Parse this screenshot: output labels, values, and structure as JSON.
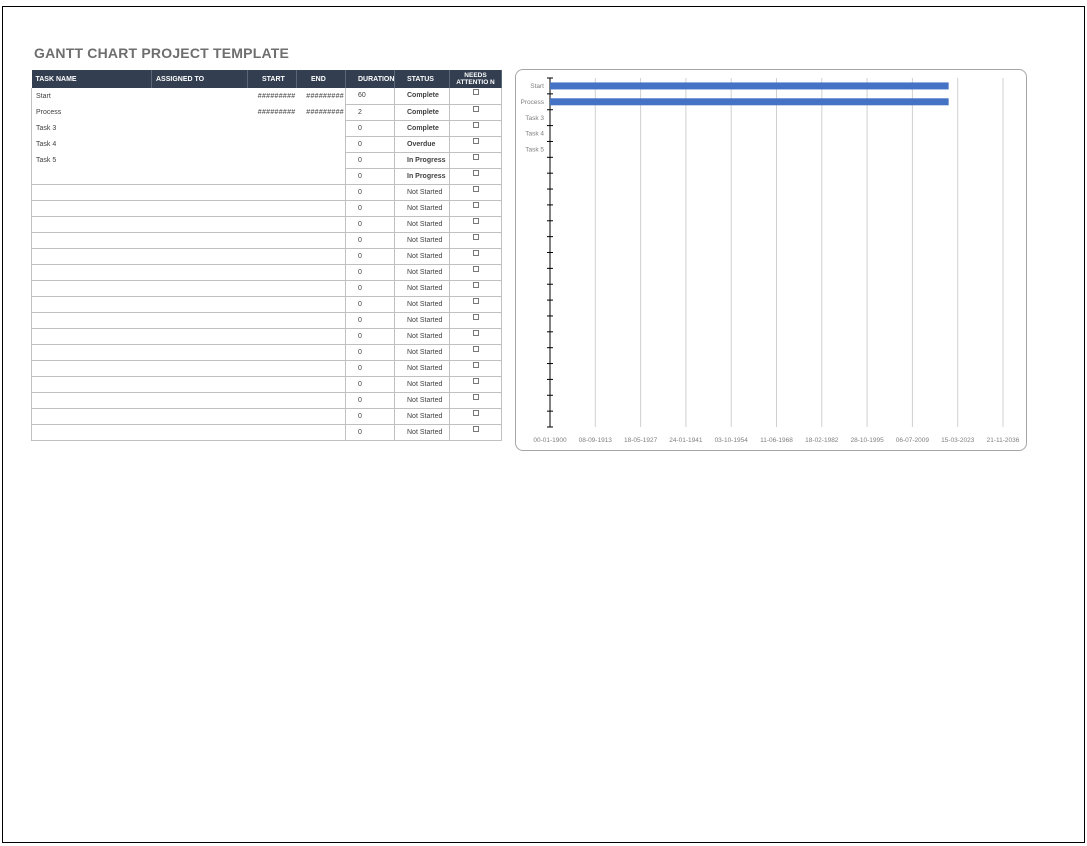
{
  "title": "GANTT CHART PROJECT TEMPLATE",
  "columns": {
    "task": "TASK NAME",
    "assigned": "ASSIGNED TO",
    "start": "START",
    "end": "END",
    "duration": "DURATION",
    "status": "STATUS",
    "needs": "NEEDS ATTENTIO N"
  },
  "rows": [
    {
      "task": "Start",
      "start": "#########",
      "end": "#########",
      "duration": "60",
      "status": "Complete",
      "status_type": "complete"
    },
    {
      "task": "Process",
      "start": "#########",
      "end": "#########",
      "duration": "2",
      "status": "Complete",
      "status_type": "complete"
    },
    {
      "task": "Task 3",
      "start": "",
      "end": "",
      "duration": "0",
      "status": "Complete",
      "status_type": "complete"
    },
    {
      "task": "Task 4",
      "start": "",
      "end": "",
      "duration": "0",
      "status": "Overdue",
      "status_type": "overdue"
    },
    {
      "task": "Task 5",
      "start": "",
      "end": "",
      "duration": "0",
      "status": "In Progress",
      "status_type": "progress"
    },
    {
      "task": "",
      "start": "",
      "end": "",
      "duration": "0",
      "status": "In Progress",
      "status_type": "progress"
    },
    {
      "task": "",
      "start": "",
      "end": "",
      "duration": "0",
      "status": "Not Started",
      "status_type": "not"
    },
    {
      "task": "",
      "start": "",
      "end": "",
      "duration": "0",
      "status": "Not Started",
      "status_type": "not"
    },
    {
      "task": "",
      "start": "",
      "end": "",
      "duration": "0",
      "status": "Not Started",
      "status_type": "not"
    },
    {
      "task": "",
      "start": "",
      "end": "",
      "duration": "0",
      "status": "Not Started",
      "status_type": "not"
    },
    {
      "task": "",
      "start": "",
      "end": "",
      "duration": "0",
      "status": "Not Started",
      "status_type": "not"
    },
    {
      "task": "",
      "start": "",
      "end": "",
      "duration": "0",
      "status": "Not Started",
      "status_type": "not"
    },
    {
      "task": "",
      "start": "",
      "end": "",
      "duration": "0",
      "status": "Not Started",
      "status_type": "not"
    },
    {
      "task": "",
      "start": "",
      "end": "",
      "duration": "0",
      "status": "Not Started",
      "status_type": "not"
    },
    {
      "task": "",
      "start": "",
      "end": "",
      "duration": "0",
      "status": "Not Started",
      "status_type": "not"
    },
    {
      "task": "",
      "start": "",
      "end": "",
      "duration": "0",
      "status": "Not Started",
      "status_type": "not"
    },
    {
      "task": "",
      "start": "",
      "end": "",
      "duration": "0",
      "status": "Not Started",
      "status_type": "not"
    },
    {
      "task": "",
      "start": "",
      "end": "",
      "duration": "0",
      "status": "Not Started",
      "status_type": "not"
    },
    {
      "task": "",
      "start": "",
      "end": "",
      "duration": "0",
      "status": "Not Started",
      "status_type": "not"
    },
    {
      "task": "",
      "start": "",
      "end": "",
      "duration": "0",
      "status": "Not Started",
      "status_type": "not"
    },
    {
      "task": "",
      "start": "",
      "end": "",
      "duration": "0",
      "status": "Not Started",
      "status_type": "not"
    },
    {
      "task": "",
      "start": "",
      "end": "",
      "duration": "0",
      "status": "Not Started",
      "status_type": "not"
    }
  ],
  "chart_data": {
    "type": "bar",
    "orientation": "horizontal",
    "categories": [
      "Start",
      "Process",
      "Task 3",
      "Task 4",
      "Task 5"
    ],
    "category_slots": 22,
    "series": [
      {
        "values": [
          44000,
          44000,
          0,
          0,
          0
        ],
        "color": "#4472c4"
      }
    ],
    "x_ticks": [
      0,
      5000,
      10000,
      15000,
      20000,
      25000,
      30000,
      35000,
      40000,
      45000,
      50000
    ],
    "x_tick_labels": [
      "00-01-1900",
      "08-09-1913",
      "18-05-1927",
      "24-01-1941",
      "03-10-1954",
      "11-06-1968",
      "18-02-1982",
      "28-10-1995",
      "06-07-2009",
      "15-03-2023",
      "21-11-2036"
    ],
    "xlim": [
      0,
      50000
    ],
    "grid": true
  }
}
